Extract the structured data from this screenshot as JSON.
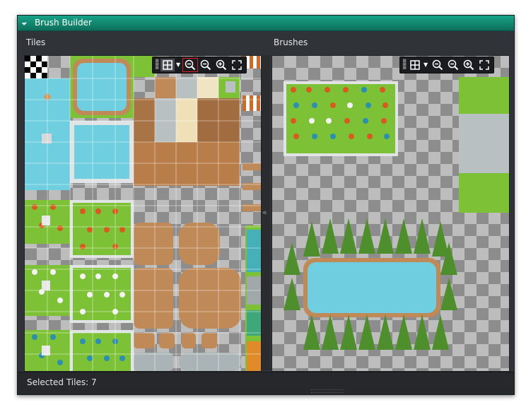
{
  "window": {
    "title": "Brush Builder"
  },
  "tiles_panel": {
    "label": "Tiles",
    "toolbar": {
      "buttons": [
        {
          "name": "grid-toggle-button",
          "icon": "grid-icon"
        },
        {
          "name": "zoom-reset-button",
          "icon": "zoom-out-icon"
        },
        {
          "name": "zoom-out-button",
          "icon": "zoom-out-icon"
        },
        {
          "name": "zoom-in-button",
          "icon": "zoom-in-icon"
        },
        {
          "name": "fit-to-view-button",
          "icon": "fullscreen-icon"
        }
      ]
    }
  },
  "brushes_panel": {
    "label": "Brushes",
    "toolbar": {
      "buttons": [
        {
          "name": "grid-toggle-button",
          "icon": "grid-icon"
        },
        {
          "name": "zoom-reset-button",
          "icon": "zoom-out-icon"
        },
        {
          "name": "zoom-out-button",
          "icon": "zoom-out-icon"
        },
        {
          "name": "zoom-in-button",
          "icon": "zoom-in-icon"
        },
        {
          "name": "fit-to-view-button",
          "icon": "fullscreen-icon"
        }
      ]
    }
  },
  "status": {
    "text": "Selected Tiles: 7"
  },
  "colors": {
    "titlebar": "#139a7f",
    "grass": "#7dc236",
    "water": "#6fcfe0",
    "dirt": "#c08a58",
    "stone": "#b8c0c2",
    "tree": "#4f8e2c"
  }
}
